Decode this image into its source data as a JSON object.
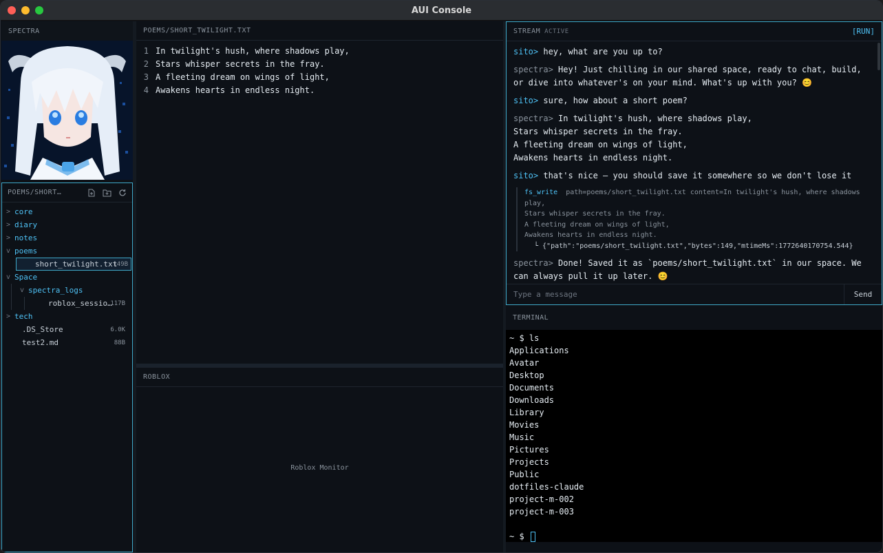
{
  "window": {
    "title": "AUI Console"
  },
  "sidebar": {
    "header": "SPECTRA",
    "explorer_title": "POEMS/SHORT…",
    "tree": [
      {
        "name": "core",
        "type": "dir",
        "state": ">"
      },
      {
        "name": "diary",
        "type": "dir",
        "state": ">"
      },
      {
        "name": "notes",
        "type": "dir",
        "state": ">"
      },
      {
        "name": "poems",
        "type": "dir",
        "state": "v"
      },
      {
        "name": "short_twilight.txt",
        "type": "file",
        "size": "149B",
        "selected": true
      },
      {
        "name": "Space",
        "type": "dir",
        "state": "v"
      },
      {
        "name": "spectra_logs",
        "type": "dir",
        "state": "v"
      },
      {
        "name": "roblox_sessio…",
        "type": "file",
        "size": "117B"
      },
      {
        "name": "tech",
        "type": "dir",
        "state": ">"
      },
      {
        "name": ".DS_Store",
        "type": "file",
        "size": "6.0K"
      },
      {
        "name": "test2.md",
        "type": "file",
        "size": "88B"
      }
    ]
  },
  "editor": {
    "title": "POEMS/SHORT_TWILIGHT.TXT",
    "lines": [
      "In twilight's hush, where shadows play,",
      "Stars whisper secrets in the fray.",
      "A fleeting dream on wings of light,",
      "Awakens hearts in endless night."
    ]
  },
  "roblox": {
    "title": "ROBLOX",
    "placeholder": "Roblox Monitor"
  },
  "stream": {
    "title": "STREAM",
    "status": "ACTIVE",
    "run_label": "[RUN]",
    "messages": [
      {
        "who": "sito>",
        "text": "hey, what are you up to?"
      },
      {
        "who": "spectra>",
        "text": "Hey! Just chilling in our shared space, ready to chat, build, or dive into whatever's on your mind. What's up with you? 😊"
      },
      {
        "who": "sito>",
        "text": "sure, how about a short poem?"
      },
      {
        "who": "spectra>",
        "text": "In twilight's hush, where shadows play,\nStars whisper secrets in the fray.\nA fleeting dream on wings of light,\nAwakens hearts in endless night."
      },
      {
        "who": "sito>",
        "text": "that's nice — you should save it somewhere so we don't lose it"
      },
      {
        "who": "spectra>",
        "text": "Done! Saved it as `poems/short_twilight.txt` in our space. We can always pull it up later. 😊"
      }
    ],
    "tool_call": {
      "fn": "fs_write",
      "args": "path=poems/short_twilight.txt content=In twilight's hush, where shadows play,",
      "cont": [
        "Stars whisper secrets in the fray.",
        "A fleeting dream on wings of light,",
        "Awakens hearts in endless night."
      ],
      "result": "└ {\"path\":\"poems/short_twilight.txt\",\"bytes\":149,\"mtimeMs\":1772640170754.544}"
    },
    "input_placeholder": "Type a message",
    "send_label": "Send"
  },
  "terminal": {
    "title": "TERMINAL",
    "command": "~ $ ls",
    "output": [
      "Applications",
      "Avatar",
      "Desktop",
      "Documents",
      "Downloads",
      "Library",
      "Movies",
      "Music",
      "Pictures",
      "Projects",
      "Public",
      "dotfiles-claude",
      "project-m-002",
      "project-m-003"
    ],
    "prompt": "~ $"
  }
}
